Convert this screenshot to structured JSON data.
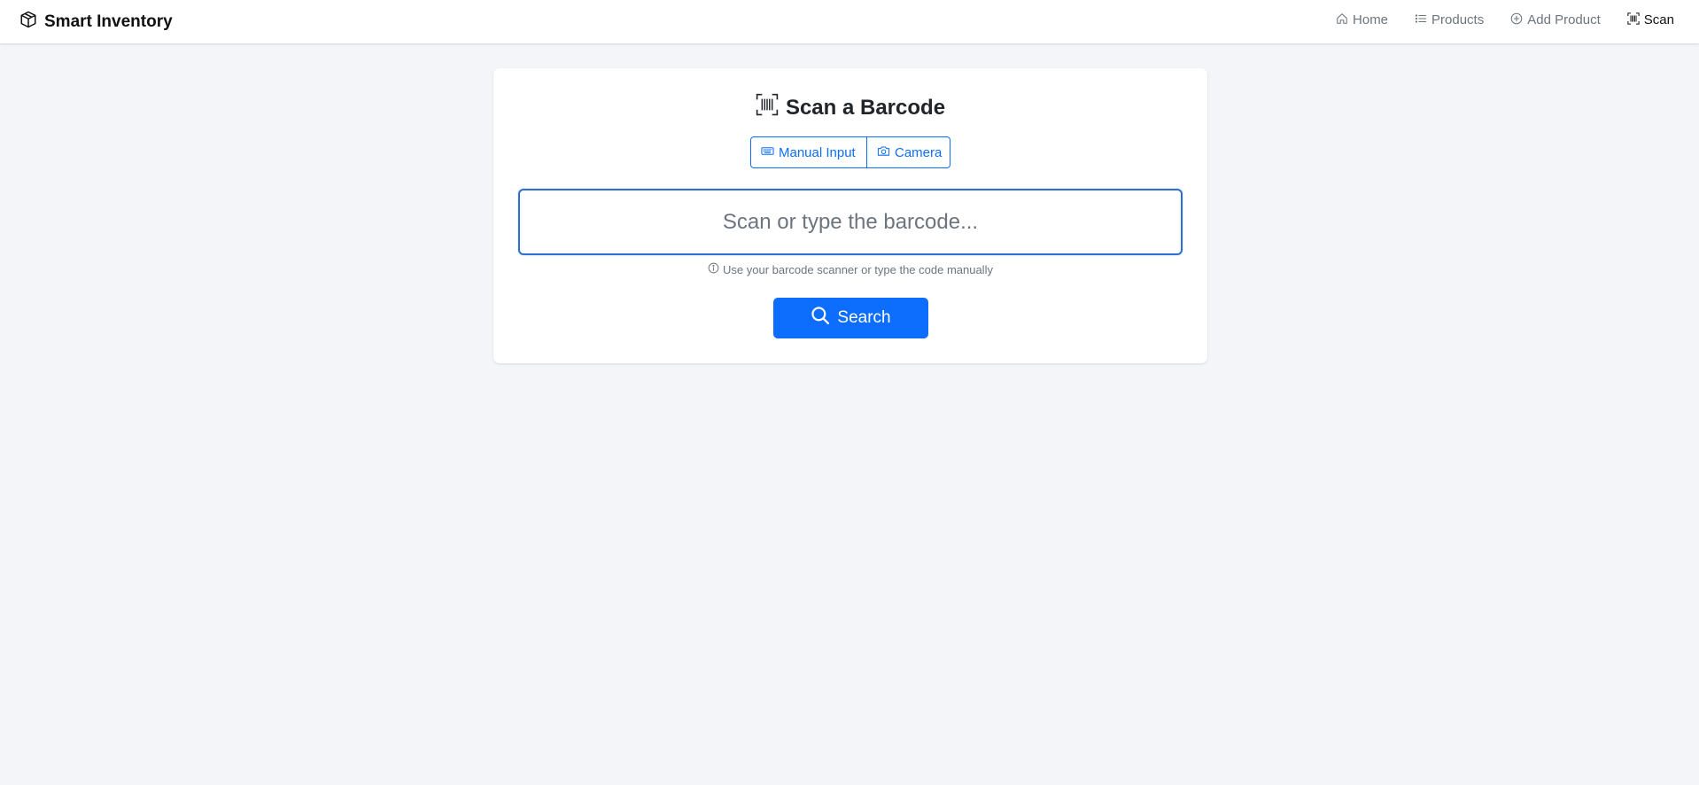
{
  "app": {
    "brand": "Smart Inventory",
    "brand_icon": "box-icon"
  },
  "nav": {
    "items": [
      {
        "label": "Home",
        "icon": "house-icon",
        "active": false
      },
      {
        "label": "Products",
        "icon": "list-icon",
        "active": false
      },
      {
        "label": "Add Product",
        "icon": "plus-circle-icon",
        "active": false
      },
      {
        "label": "Scan",
        "icon": "barcode-scan-icon",
        "active": true
      }
    ]
  },
  "scan": {
    "title": "Scan a Barcode",
    "title_icon": "barcode-scan-icon",
    "modes": [
      {
        "label": "Manual Input",
        "icon": "keyboard-icon"
      },
      {
        "label": "Camera",
        "icon": "camera-icon"
      }
    ],
    "input": {
      "value": "",
      "placeholder": "Scan or type the barcode..."
    },
    "help_text": "Use your barcode scanner or type the code manually",
    "help_icon": "info-circle-icon",
    "search_label": "Search",
    "search_icon": "search-icon"
  },
  "colors": {
    "primary": "#0d6efd",
    "background": "#f3f5f8",
    "muted": "#6c757d"
  }
}
